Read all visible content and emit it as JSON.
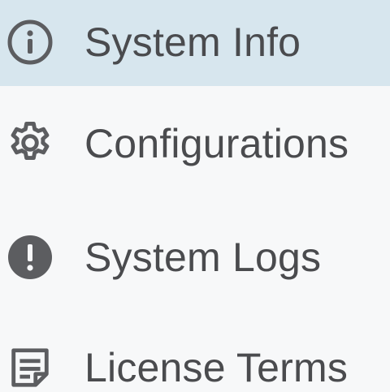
{
  "menu": {
    "items": [
      {
        "label": "System Info",
        "icon": "info-circle-icon",
        "active": true
      },
      {
        "label": "Configurations",
        "icon": "gear-icon",
        "active": false
      },
      {
        "label": "System Logs",
        "icon": "alert-circle-icon",
        "active": false
      },
      {
        "label": "License Terms",
        "icon": "document-icon",
        "active": false
      }
    ]
  },
  "colors": {
    "active_background": "#d7e6ee",
    "background": "#f7f8f9",
    "text": "#4a4b4e",
    "icon": "#5c5d60"
  }
}
